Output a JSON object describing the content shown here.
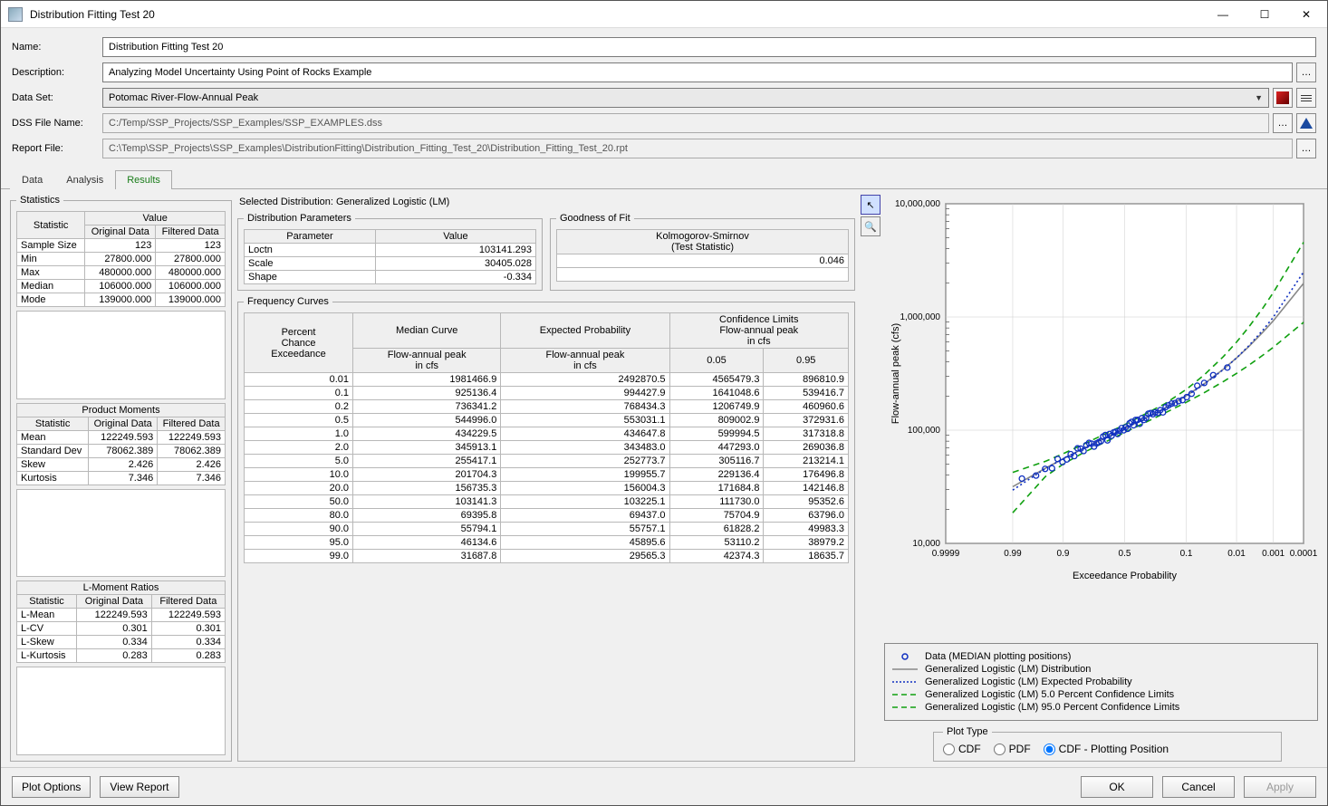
{
  "window": {
    "title": "Distribution Fitting Test 20"
  },
  "form": {
    "name_label": "Name:",
    "name_value": "Distribution Fitting Test 20",
    "desc_label": "Description:",
    "desc_value": "Analyzing Model Uncertainty Using Point of Rocks Example",
    "dataset_label": "Data Set:",
    "dataset_value": "Potomac River-Flow-Annual Peak",
    "dss_label": "DSS File Name:",
    "dss_value": "C:/Temp/SSP_Projects/SSP_Examples/SSP_EXAMPLES.dss",
    "report_label": "Report File:",
    "report_value": "C:\\Temp\\SSP_Projects\\SSP_Examples\\DistributionFitting\\Distribution_Fitting_Test_20\\Distribution_Fitting_Test_20.rpt"
  },
  "tabs": {
    "data": "Data",
    "analysis": "Analysis",
    "results": "Results"
  },
  "stats": {
    "legend": "Statistics",
    "header_stat": "Statistic",
    "header_value": "Value",
    "header_orig": "Original Data",
    "header_filt": "Filtered Data",
    "basic": [
      {
        "label": "Sample Size",
        "orig": "123",
        "filt": "123"
      },
      {
        "label": "Min",
        "orig": "27800.000",
        "filt": "27800.000"
      },
      {
        "label": "Max",
        "orig": "480000.000",
        "filt": "480000.000"
      },
      {
        "label": "Median",
        "orig": "106000.000",
        "filt": "106000.000"
      },
      {
        "label": "Mode",
        "orig": "139000.000",
        "filt": "139000.000"
      }
    ],
    "product_caption": "Product Moments",
    "product": [
      {
        "label": "Mean",
        "orig": "122249.593",
        "filt": "122249.593"
      },
      {
        "label": "Standard Dev",
        "orig": "78062.389",
        "filt": "78062.389"
      },
      {
        "label": "Skew",
        "orig": "2.426",
        "filt": "2.426"
      },
      {
        "label": "Kurtosis",
        "orig": "7.346",
        "filt": "7.346"
      }
    ],
    "lmoment_caption": "L-Moment Ratios",
    "lmoment": [
      {
        "label": "L-Mean",
        "orig": "122249.593",
        "filt": "122249.593"
      },
      {
        "label": "L-CV",
        "orig": "0.301",
        "filt": "0.301"
      },
      {
        "label": "L-Skew",
        "orig": "0.334",
        "filt": "0.334"
      },
      {
        "label": "L-Kurtosis",
        "orig": "0.283",
        "filt": "0.283"
      }
    ]
  },
  "distribution": {
    "selected_label": "Selected Distribution: Generalized Logistic (LM)",
    "params_legend": "Distribution Parameters",
    "param_h1": "Parameter",
    "param_h2": "Value",
    "params": [
      {
        "name": "Loctn",
        "val": "103141.293"
      },
      {
        "name": "Scale",
        "val": "30405.028"
      },
      {
        "name": "Shape",
        "val": "-0.334"
      }
    ],
    "gof_legend": "Goodness of Fit",
    "gof_name": "Kolmogorov-Smirnov",
    "gof_sub": "(Test Statistic)",
    "gof_value": "0.046"
  },
  "freq": {
    "legend": "Frequency Curves",
    "h_pct1": "Percent",
    "h_pct2": "Chance",
    "h_pct3": "Exceedance",
    "h_median": "Median Curve",
    "h_expected": "Expected Probability",
    "h_conf1": "Confidence Limits",
    "h_conf2": "Flow-annual peak",
    "h_conf3": "in cfs",
    "h_flow": "Flow-annual peak",
    "h_flow2": "in cfs",
    "h_c05": "0.05",
    "h_c95": "0.95",
    "rows": [
      {
        "p": "0.01",
        "m": "1981466.9",
        "e": "2492870.5",
        "c05": "4565479.3",
        "c95": "896810.9"
      },
      {
        "p": "0.1",
        "m": "925136.4",
        "e": "994427.9",
        "c05": "1641048.6",
        "c95": "539416.7"
      },
      {
        "p": "0.2",
        "m": "736341.2",
        "e": "768434.3",
        "c05": "1206749.9",
        "c95": "460960.6"
      },
      {
        "p": "0.5",
        "m": "544996.0",
        "e": "553031.1",
        "c05": "809002.9",
        "c95": "372931.6"
      },
      {
        "p": "1.0",
        "m": "434229.5",
        "e": "434647.8",
        "c05": "599994.5",
        "c95": "317318.8"
      },
      {
        "p": "2.0",
        "m": "345913.1",
        "e": "343483.0",
        "c05": "447293.0",
        "c95": "269036.8"
      },
      {
        "p": "5.0",
        "m": "255417.1",
        "e": "252773.7",
        "c05": "305116.7",
        "c95": "213214.1"
      },
      {
        "p": "10.0",
        "m": "201704.3",
        "e": "199955.7",
        "c05": "229136.4",
        "c95": "176496.8"
      },
      {
        "p": "20.0",
        "m": "156735.3",
        "e": "156004.3",
        "c05": "171684.8",
        "c95": "142146.8"
      },
      {
        "p": "50.0",
        "m": "103141.3",
        "e": "103225.1",
        "c05": "111730.0",
        "c95": "95352.6"
      },
      {
        "p": "80.0",
        "m": "69395.8",
        "e": "69437.0",
        "c05": "75704.9",
        "c95": "63796.0"
      },
      {
        "p": "90.0",
        "m": "55794.1",
        "e": "55757.1",
        "c05": "61828.2",
        "c95": "49983.3"
      },
      {
        "p": "95.0",
        "m": "46134.6",
        "e": "45895.6",
        "c05": "53110.2",
        "c95": "38979.2"
      },
      {
        "p": "99.0",
        "m": "31687.8",
        "e": "29565.3",
        "c05": "42374.3",
        "c95": "18635.7"
      }
    ]
  },
  "chart": {
    "ylabel": "Flow-annual peak (cfs)",
    "xlabel": "Exceedance Probability",
    "yticks": [
      "10,000",
      "100,000",
      "1,000,000",
      "10,000,000"
    ],
    "xticks": [
      "0.9999",
      "0.99",
      "0.9",
      "0.5",
      "0.1",
      "0.01",
      "0.001",
      "0.0001"
    ]
  },
  "chart_data": {
    "type": "line",
    "xlabel": "Exceedance Probability",
    "ylabel": "Flow-annual peak (cfs)",
    "x_scale": "probability",
    "y_scale": "log",
    "ylim": [
      10000,
      10000000
    ],
    "xticks": [
      0.9999,
      0.99,
      0.9,
      0.5,
      0.1,
      0.01,
      0.001,
      0.0001
    ],
    "series": [
      {
        "name": "Generalized Logistic (LM) Distribution",
        "style": "solid",
        "color": "#888888",
        "x": [
          99.0,
          95.0,
          90.0,
          80.0,
          50.0,
          20.0,
          10.0,
          5.0,
          2.0,
          1.0,
          0.5,
          0.2,
          0.1,
          0.01
        ],
        "y": [
          31687.8,
          46134.6,
          55794.1,
          69395.8,
          103141.3,
          156735.3,
          201704.3,
          255417.1,
          345913.1,
          434229.5,
          544996.0,
          736341.2,
          925136.4,
          1981466.9
        ]
      },
      {
        "name": "Generalized Logistic (LM) Expected Probability",
        "style": "dotted",
        "color": "#1030c0",
        "x": [
          99.0,
          95.0,
          90.0,
          80.0,
          50.0,
          20.0,
          10.0,
          5.0,
          2.0,
          1.0,
          0.5,
          0.2,
          0.1,
          0.01
        ],
        "y": [
          29565.3,
          45895.6,
          55757.1,
          69437.0,
          103225.1,
          156004.3,
          199955.7,
          252773.7,
          343483.0,
          434647.8,
          553031.1,
          768434.3,
          994427.9,
          2492870.5
        ]
      },
      {
        "name": "Generalized Logistic (LM) 5.0 Percent Confidence Limits",
        "style": "dashed",
        "color": "#10a010",
        "x": [
          99.0,
          95.0,
          90.0,
          80.0,
          50.0,
          20.0,
          10.0,
          5.0,
          2.0,
          1.0,
          0.5,
          0.2,
          0.1,
          0.01
        ],
        "y": [
          42374.3,
          53110.2,
          61828.2,
          75704.9,
          111730.0,
          171684.8,
          229136.4,
          305116.7,
          447293.0,
          599994.5,
          809002.9,
          1206749.9,
          1641048.6,
          4565479.3
        ]
      },
      {
        "name": "Generalized Logistic (LM) 95.0 Percent Confidence Limits",
        "style": "dashed",
        "color": "#10a010",
        "x": [
          99.0,
          95.0,
          90.0,
          80.0,
          50.0,
          20.0,
          10.0,
          5.0,
          2.0,
          1.0,
          0.5,
          0.2,
          0.1,
          0.01
        ],
        "y": [
          18635.7,
          38979.2,
          49983.3,
          63796.0,
          95352.6,
          142146.8,
          176496.8,
          213214.1,
          269036.8,
          317318.8,
          372931.6,
          460960.6,
          539416.7,
          896810.9
        ]
      }
    ],
    "data_points": {
      "name": "Data (MEDIAN plotting positions)",
      "marker": "open-circle",
      "color": "#1030c0",
      "note": "Approximate plotting positions of 123 observed annual peaks; individual points estimated from chart.",
      "count": 123,
      "range_y": [
        27800,
        480000
      ]
    }
  },
  "legend": {
    "data": "Data (MEDIAN plotting positions)",
    "l1": "Generalized Logistic (LM) Distribution",
    "l2": "Generalized Logistic (LM) Expected Probability",
    "l3": "Generalized Logistic (LM) 5.0 Percent Confidence Limits",
    "l4": "Generalized Logistic (LM) 95.0 Percent Confidence Limits"
  },
  "plottype": {
    "legend": "Plot Type",
    "cdf": "CDF",
    "pdf": "PDF",
    "cdfpp": "CDF - Plotting Position"
  },
  "footer": {
    "plot_options": "Plot Options",
    "view_report": "View Report",
    "ok": "OK",
    "cancel": "Cancel",
    "apply": "Apply"
  }
}
